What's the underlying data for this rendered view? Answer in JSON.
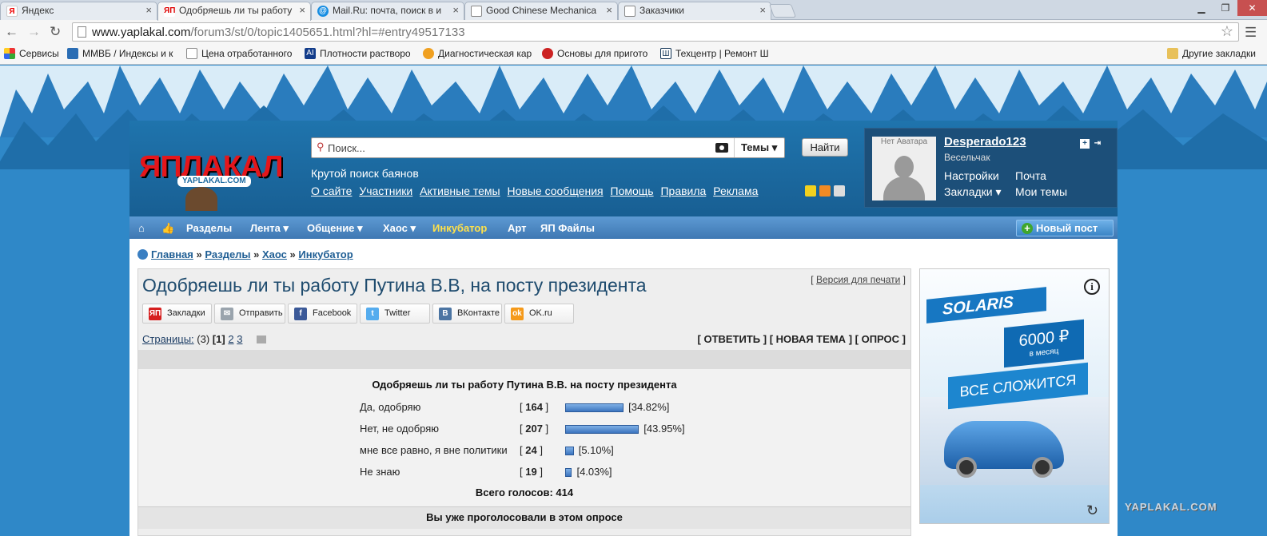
{
  "browser": {
    "tabs": [
      {
        "title": "Яндекс",
        "icon": "yandex-icon",
        "active": false
      },
      {
        "title": "Одобряешь ли ты работу",
        "icon": "yaplakal-icon",
        "active": true
      },
      {
        "title": "Mail.Ru: почта, поиск в и",
        "icon": "mailru-icon",
        "active": false
      },
      {
        "title": "Good Chinese Mechanica",
        "icon": "page-icon",
        "active": false
      },
      {
        "title": "Заказчики",
        "icon": "page-icon",
        "active": false
      }
    ],
    "url_host": "www.yaplakal.com",
    "url_path": "/forum3/st/0/topic1405651.html?hl=#entry49517133",
    "bookmarks": [
      {
        "label": "Сервисы",
        "icon": "apps-icon"
      },
      {
        "label": "ММВБ / Индексы и к",
        "icon": "mmvb-icon"
      },
      {
        "label": "Цена отработанного",
        "icon": "page-icon"
      },
      {
        "label": "Плотности растворо",
        "icon": "ai-icon"
      },
      {
        "label": "Диагностическая кар",
        "icon": "diag-icon"
      },
      {
        "label": "Основы для пригото",
        "icon": "food-icon"
      },
      {
        "label": "Техцентр | Ремонт Ш",
        "icon": "sh-icon"
      }
    ],
    "other_bookmarks": "Другие закладки"
  },
  "header": {
    "logo_text": "ЯПЛАКАЛ",
    "logo_domain": "YAPLAKAL.COM",
    "search_placeholder": "Поиск...",
    "search_scope": "Темы",
    "find_button": "Найти",
    "tagline": "Крутой поиск баянов",
    "links": [
      "О сайте",
      "Участники",
      "Активные темы",
      "Новые сообщения",
      "Помощь",
      "Правила",
      "Реклама"
    ]
  },
  "user": {
    "no_avatar": "Нет Аватара",
    "name": "Desperado123",
    "rank": "Весельчак",
    "settings": "Настройки",
    "mail": "Почта",
    "bookmarks": "Закладки",
    "my_topics": "Мои темы"
  },
  "nav": {
    "items": [
      "Разделы",
      "Лента",
      "Общение",
      "Хаос",
      "Инкубатор",
      "Арт",
      "ЯП Файлы"
    ],
    "new_post": "Новый пост"
  },
  "breadcrumb": [
    "Главная",
    "Разделы",
    "Хаос",
    "Инкубатор"
  ],
  "topic": {
    "title": "Одобряешь ли ты работу Путина В.В, на посту президента",
    "print_version": "Версия для печати",
    "share": [
      {
        "label": "Закладки",
        "icon": "yp-bookmark-icon",
        "color": "#d61f1f"
      },
      {
        "label": "Отправить",
        "icon": "mail-icon",
        "color": "#9aa4ad"
      },
      {
        "label": "Facebook",
        "icon": "facebook-icon",
        "color": "#3b5998"
      },
      {
        "label": "Twitter",
        "icon": "twitter-icon",
        "color": "#55acee"
      },
      {
        "label": "ВКонтакте",
        "icon": "vk-icon",
        "color": "#4c75a3"
      },
      {
        "label": "OK.ru",
        "icon": "ok-icon",
        "color": "#f59a1b"
      }
    ],
    "pages_label": "Страницы:",
    "pages_count": "(3)",
    "current_page": "1",
    "pages": [
      "2",
      "3"
    ],
    "actions": [
      "ОТВЕТИТЬ",
      "НОВАЯ ТЕМА",
      "ОПРОС"
    ]
  },
  "poll": {
    "question": "Одобряешь ли ты работу Путина В.В. на посту президента",
    "options": [
      {
        "label": "Да, одобряю",
        "votes": 164,
        "percent": 34.82,
        "percent_text": "[34.82%]"
      },
      {
        "label": "Нет, не одобряю",
        "votes": 207,
        "percent": 43.95,
        "percent_text": "[43.95%]"
      },
      {
        "label": "мне все равно, я вне политики",
        "votes": 24,
        "percent": 5.1,
        "percent_text": "[5.10%]"
      },
      {
        "label": "Не знаю",
        "votes": 19,
        "percent": 4.03,
        "percent_text": "[4.03%]"
      }
    ],
    "total": "Всего голосов: 414",
    "voted_message": "Вы уже проголосовали в этом опросе"
  },
  "ad": {
    "brand": "SOLARIS",
    "price": "6000 ₽",
    "price_sub": "в месяц",
    "slogan": "ВСЕ СЛОЖИТСЯ"
  },
  "watermark": "YAPLAKAL.COM"
}
